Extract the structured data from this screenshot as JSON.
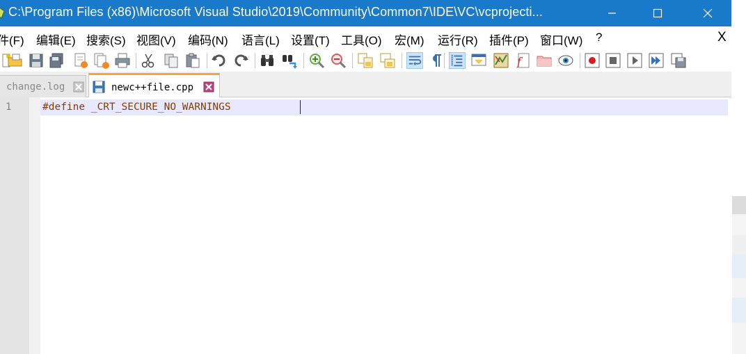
{
  "window": {
    "title": "C:\\Program Files (x86)\\Microsoft Visual Studio\\2019\\Community\\Common7\\IDE\\VC\\vcprojecti...",
    "accent": "#1979ca"
  },
  "menu": {
    "items": [
      {
        "label": "件(F)"
      },
      {
        "label": "编辑(E)"
      },
      {
        "label": "搜索(S)"
      },
      {
        "label": "视图(V)"
      },
      {
        "label": "编码(N)"
      },
      {
        "label": "语言(L)"
      },
      {
        "label": "设置(T)"
      },
      {
        "label": "工具(O)"
      },
      {
        "label": "宏(M)"
      },
      {
        "label": "运行(R)"
      },
      {
        "label": "插件(P)"
      },
      {
        "label": "窗口(W)"
      },
      {
        "label": "?"
      }
    ],
    "close_label": "X"
  },
  "toolbar": {
    "buttons": [
      "new-file-icon",
      "open-file-icon",
      "save-icon",
      "save-all-icon",
      "close-icon",
      "close-all-icon",
      "print-icon",
      "cut-icon",
      "copy-icon",
      "paste-icon",
      "undo-icon",
      "redo-icon",
      "find-icon",
      "replace-icon",
      "zoom-in-icon",
      "zoom-out-icon",
      "sync-vertical-icon",
      "sync-horizontal-icon",
      "word-wrap-icon",
      "show-all-chars-icon",
      "indent-guide-icon",
      "user-language-icon",
      "document-map-icon",
      "function-list-icon",
      "folder-workspace-icon",
      "monitoring-icon",
      "record-macro-icon",
      "stop-recording-icon",
      "play-macro-icon",
      "run-macro-multiple-icon",
      "save-macro-icon"
    ]
  },
  "tabs": [
    {
      "label": "change.log",
      "active": false
    },
    {
      "label": "newc++file.cpp",
      "active": true
    }
  ],
  "editor": {
    "line_numbers": [
      "1"
    ],
    "lines": [
      "#define _CRT_SECURE_NO_WARNINGS"
    ]
  }
}
